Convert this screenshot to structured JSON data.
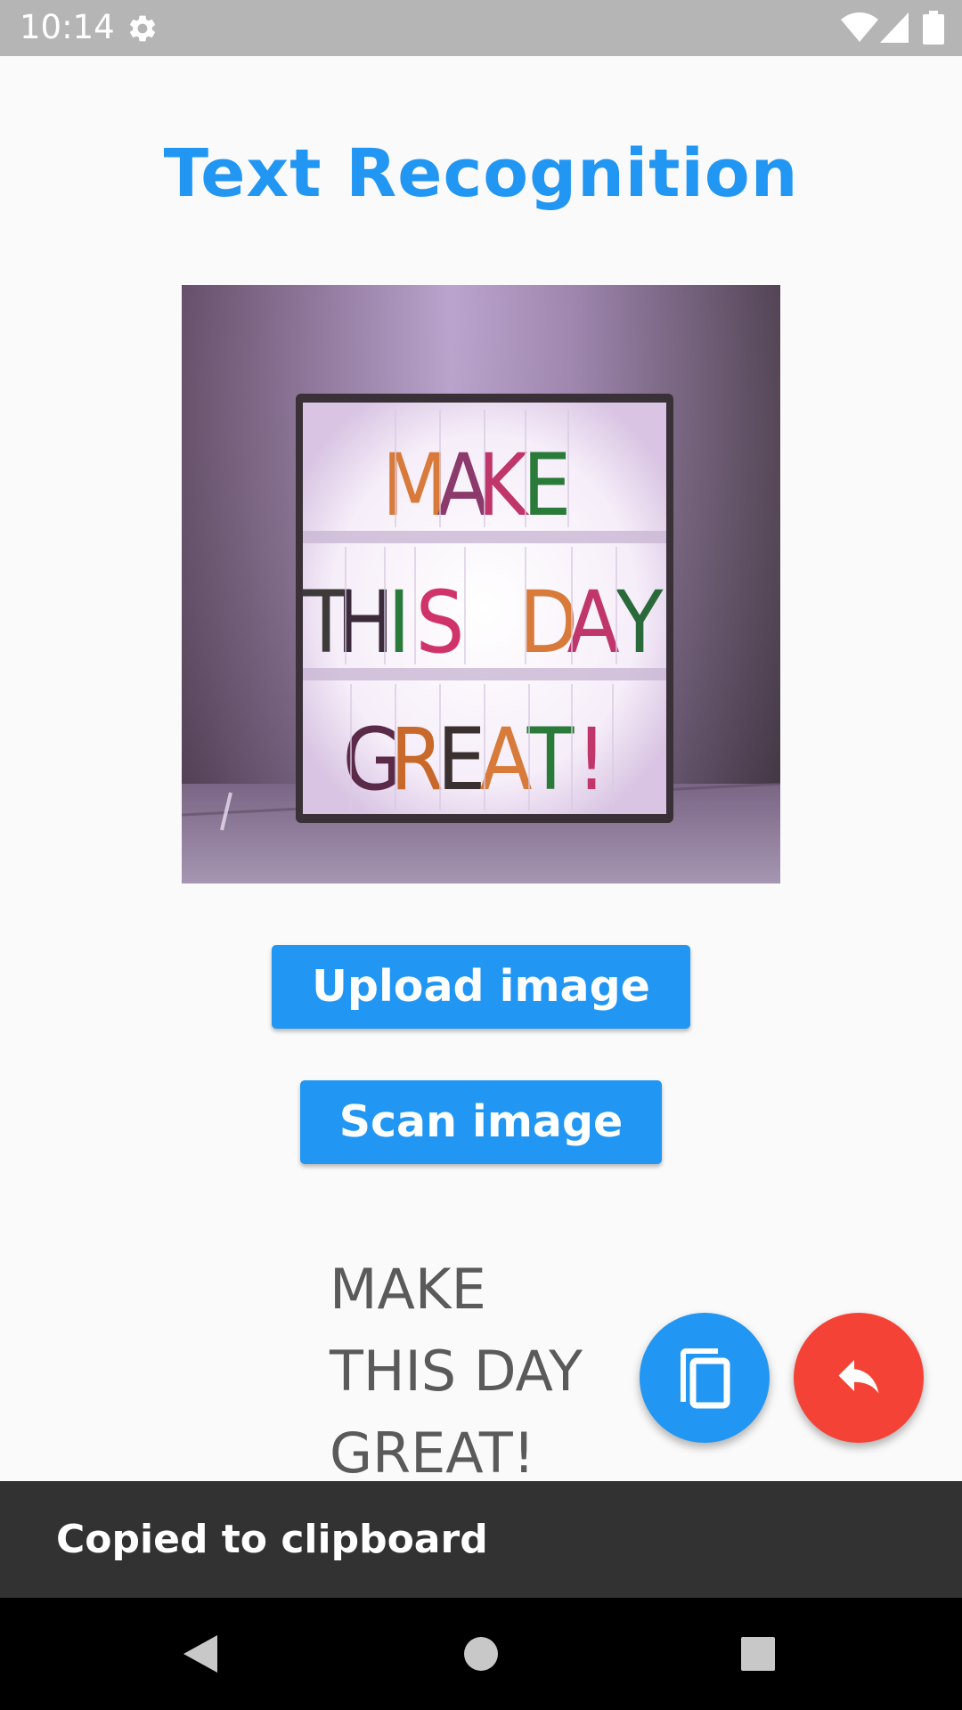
{
  "status_bar": {
    "time": "10:14",
    "icons": [
      "settings-icon",
      "wifi-icon",
      "signal-icon",
      "battery-icon"
    ]
  },
  "page": {
    "title": "Text Recognition"
  },
  "preview": {
    "alt": "Lightbox sign reading MAKE THIS DAY GREAT!",
    "rows": [
      {
        "letters": [
          "M",
          "A",
          "K",
          "E"
        ]
      },
      {
        "letters": [
          "T",
          "H",
          "I",
          "S",
          " ",
          "D",
          "A",
          "Y"
        ]
      },
      {
        "letters": [
          "G",
          "R",
          "E",
          "A",
          "T",
          "!"
        ]
      }
    ]
  },
  "buttons": {
    "upload_label": "Upload image",
    "scan_label": "Scan image"
  },
  "result": {
    "lines": [
      "MAKE",
      "THIS DAY",
      "GREAT!"
    ]
  },
  "fabs": {
    "copy_icon": "copy-icon",
    "reply_icon": "reply-icon"
  },
  "snackbar": {
    "message": "Copied to clipboard"
  },
  "nav_bar": {
    "icons": [
      "back-icon",
      "home-icon",
      "recents-icon"
    ]
  },
  "colors": {
    "accent": "#2196f3",
    "fab_red": "#f44336",
    "background": "#fafafa",
    "status_bar": "#b5b5b5",
    "snackbar": "#323232",
    "result_text": "#5a5a5a"
  }
}
